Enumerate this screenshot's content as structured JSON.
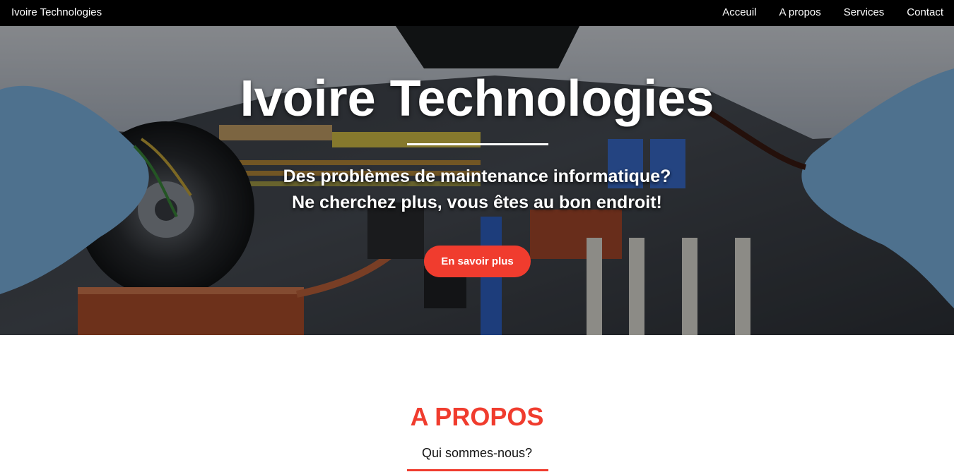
{
  "navbar": {
    "brand": "Ivoire Technologies",
    "links": [
      "Acceuil",
      "A propos",
      "Services",
      "Contact"
    ]
  },
  "hero": {
    "title": "Ivoire Technologies",
    "subtitle_line1": "Des problèmes de maintenance informatique?",
    "subtitle_line2": "Ne cherchez plus, vous êtes au bon endroit!",
    "cta_label": "En savoir plus"
  },
  "about": {
    "title": "A PROPOS",
    "subtitle": "Qui sommes-nous?"
  },
  "colors": {
    "accent": "#f03c2e",
    "navbar_bg": "#000000"
  }
}
